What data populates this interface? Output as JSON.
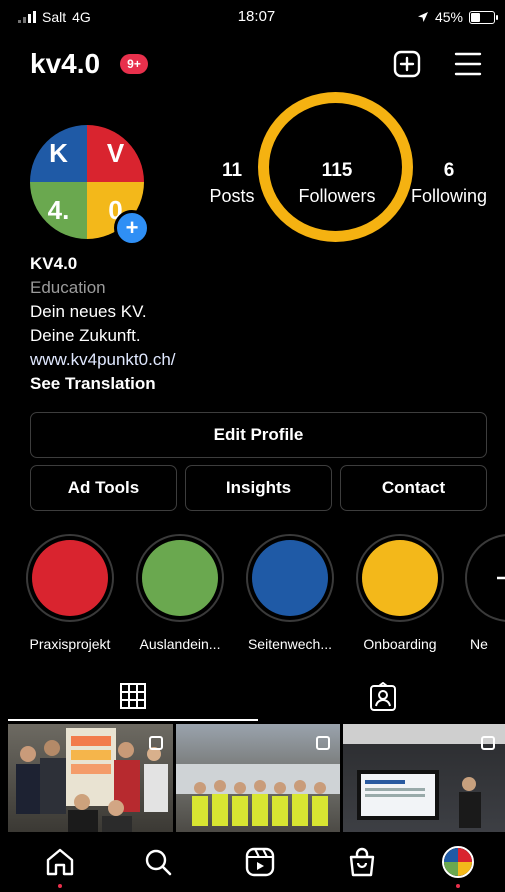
{
  "status_bar": {
    "carrier": "Salt",
    "network": "4G",
    "time": "18:07",
    "battery_text": "45%",
    "battery_level": 0.45
  },
  "header": {
    "username": "kv4.0",
    "notification_badge": "9+"
  },
  "profile": {
    "avatar_letters": [
      "K",
      "V",
      "4.",
      "0"
    ],
    "avatar_colors": [
      "#1f5aa6",
      "#d9242f",
      "#6aa84f",
      "#f3b81a"
    ],
    "stats": [
      {
        "number": "11",
        "label": "Posts"
      },
      {
        "number": "115",
        "label": "Followers"
      },
      {
        "number": "6",
        "label": "Following"
      }
    ],
    "name": "KV4.0",
    "category": "Education",
    "bio_lines": [
      "Dein neues KV.",
      "Deine Zukunft."
    ],
    "link": "www.kv4punkt0.ch/",
    "see_translation": "See Translation"
  },
  "buttons": {
    "edit_profile": "Edit Profile",
    "ad_tools": "Ad Tools",
    "insights": "Insights",
    "contact": "Contact"
  },
  "highlights": [
    {
      "label": "Praxisprojekt",
      "color": "#d9242f"
    },
    {
      "label": "Auslandein...",
      "color": "#6aa84f"
    },
    {
      "label": "Seitenwech...",
      "color": "#1f5aa6"
    },
    {
      "label": "Onboarding",
      "color": "#f3b81a"
    },
    {
      "label": "Ne",
      "icon": "plus-icon"
    }
  ],
  "tabs": [
    {
      "icon": "grid-icon",
      "active": true
    },
    {
      "icon": "tagged-icon",
      "active": false
    }
  ],
  "posts": [
    {
      "icon": "multi-photo-icon"
    },
    {
      "icon": "multi-photo-icon"
    },
    {
      "icon": "multi-photo-icon"
    }
  ],
  "bottom_nav": [
    "home-icon",
    "search-icon",
    "reels-icon",
    "shop-icon",
    "profile-avatar"
  ],
  "colors": {
    "highlight_ring": "#f5b211",
    "badge": "#e8304c",
    "link": "#e0e8ff"
  }
}
